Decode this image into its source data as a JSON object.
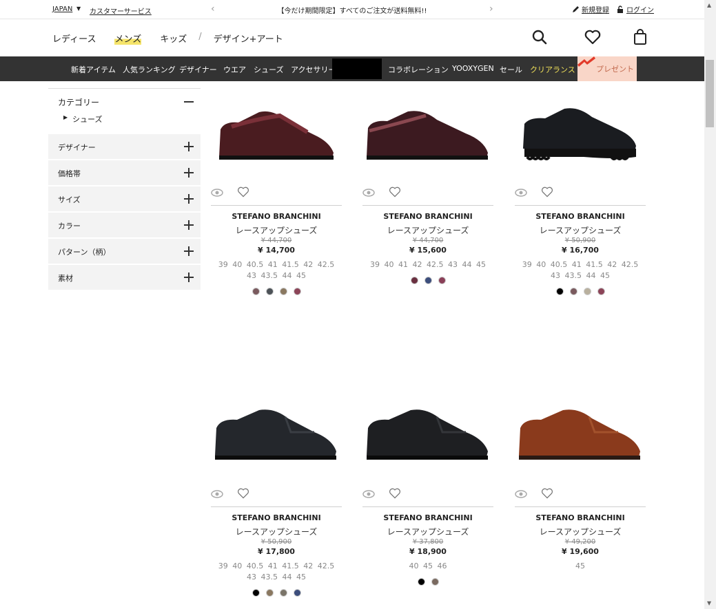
{
  "topbar": {
    "country": "JAPAN",
    "customer_service": "カスタマーサービス",
    "promo": "【今だけ期間限定】すべてのご注文が送料無料!!",
    "register": "新規登録",
    "login": "ログイン"
  },
  "header": {
    "nav": [
      "レディース",
      "メンズ",
      "キッズ",
      "/",
      "デザイン+アート"
    ],
    "active_nav": "メンズ"
  },
  "catstrip": {
    "items": [
      "新着アイテム",
      "人気ランキング",
      "デザイナー",
      "ウエア",
      "シューズ",
      "アクセサリー",
      "コラボレーション",
      "YOOXYGEN",
      "セール",
      "クリアランス",
      "プレゼント"
    ]
  },
  "sidebar": {
    "category_title": "カテゴリー",
    "category_item": "シューズ",
    "filters": [
      "デザイナー",
      "価格帯",
      "サイズ",
      "カラー",
      "パターン（柄）",
      "素材"
    ]
  },
  "products": [
    {
      "brand": "STEFANO BRANCHINI",
      "type": "レースアップシューズ",
      "old": "¥ 44,700",
      "price": "¥ 14,700",
      "sizes": "39  40  40.5  41  41.5  42  42.5  43  43.5  44  45",
      "colors": [
        "#7a5a5e",
        "#4c5257",
        "#8a7860",
        "#8c4458"
      ]
    },
    {
      "brand": "STEFANO BRANCHINI",
      "type": "レースアップシューズ",
      "old": "¥ 44,700",
      "price": "¥ 15,600",
      "sizes": "39  40  41  42  42.5  43  44  45",
      "colors": [
        "#6a3040",
        "#3c4e7c",
        "#8a3f58"
      ]
    },
    {
      "brand": "STEFANO BRANCHINI",
      "type": "レースアップシューズ",
      "old": "¥ 50,900",
      "price": "¥ 16,700",
      "sizes": "39  40  40.5  41  41.5  42  42.5  43  43.5  44  45",
      "colors": [
        "#000000",
        "#7a5a5e",
        "#b9b09e",
        "#8c4458"
      ]
    },
    {
      "brand": "STEFANO BRANCHINI",
      "type": "レースアップシューズ",
      "old": "¥ 50,900",
      "price": "¥ 17,800",
      "sizes": "39  40  40.5  41  41.5  42  42.5  43  43.5  44  45",
      "colors": [
        "#000000",
        "#8a7860",
        "#7a7468",
        "#3c4e7c"
      ]
    },
    {
      "brand": "STEFANO BRANCHINI",
      "type": "レースアップシューズ",
      "old": "¥ 37,800",
      "price": "¥ 18,900",
      "sizes": "40  45  46",
      "colors": [
        "#000000",
        "#7a6a60"
      ]
    },
    {
      "brand": "STEFANO BRANCHINI",
      "type": "レースアップシューズ",
      "old": "¥ 49,200",
      "price": "¥ 19,600",
      "sizes": "45",
      "colors": []
    }
  ]
}
